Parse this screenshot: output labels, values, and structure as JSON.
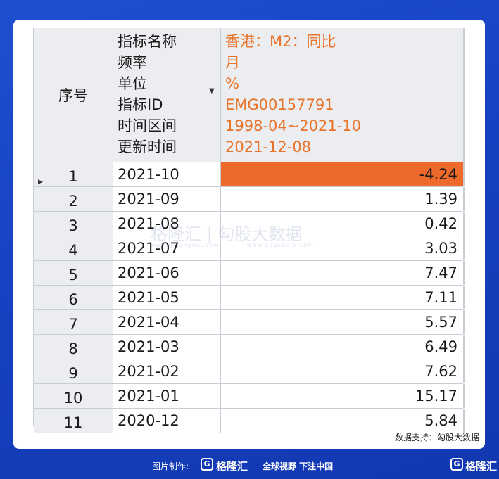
{
  "header": {
    "index_label": "序号",
    "meta_labels": [
      "指标名称",
      "频率",
      "单位",
      "指标ID",
      "时间区间",
      "更新时间"
    ],
    "meta_values": [
      "香港：M2：同比",
      "月",
      "%",
      "EMG00157791",
      "1998-04~2021-10",
      "2021-12-08"
    ]
  },
  "rows": [
    {
      "index": "1",
      "date": "2021-10",
      "value": "-4.24"
    },
    {
      "index": "2",
      "date": "2021-09",
      "value": "1.39"
    },
    {
      "index": "3",
      "date": "2021-08",
      "value": "0.42"
    },
    {
      "index": "4",
      "date": "2021-07",
      "value": "3.03"
    },
    {
      "index": "5",
      "date": "2021-06",
      "value": "7.47"
    },
    {
      "index": "6",
      "date": "2021-05",
      "value": "7.11"
    },
    {
      "index": "7",
      "date": "2021-04",
      "value": "5.57"
    },
    {
      "index": "8",
      "date": "2021-03",
      "value": "6.49"
    },
    {
      "index": "9",
      "date": "2021-02",
      "value": "7.62"
    },
    {
      "index": "10",
      "date": "2021-01",
      "value": "15.17"
    },
    {
      "index": "11",
      "date": "2020-12",
      "value": "5.84"
    }
  ],
  "watermark": {
    "brand": "格隆汇",
    "partner": "勾股大数据",
    "brand_url": "www.gelonghui.com",
    "partner_url": "www.gogudata.com"
  },
  "support_text": "数据支持：勾股大数据",
  "footer": {
    "made_by": "图片制作:",
    "logo_mark": "G",
    "logo_text": "格隆汇",
    "slogan": "全球视野 下注中国",
    "logo2_mark": "G",
    "logo2_text": "格隆汇"
  },
  "colors": {
    "accent_orange": "#ee6a2a",
    "value_text_orange": "#e8742a",
    "background_blue": "#1741c2"
  }
}
